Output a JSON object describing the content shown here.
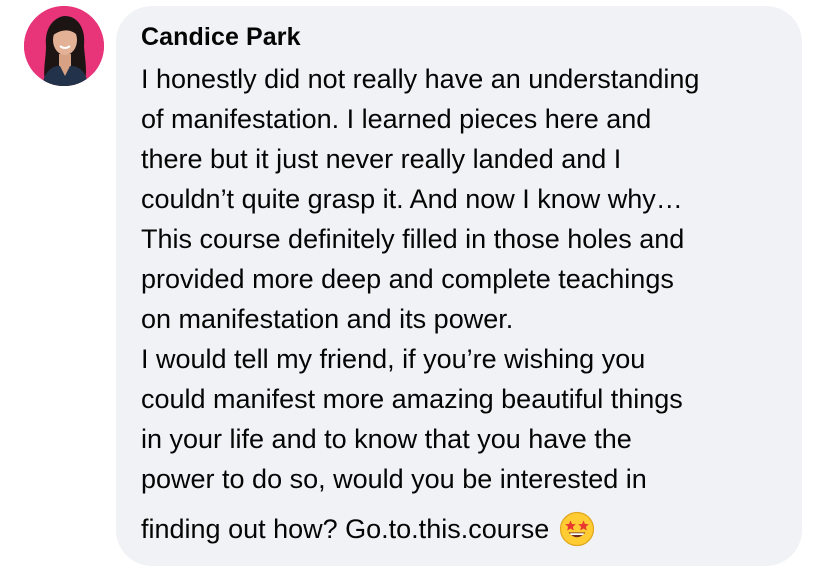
{
  "comment": {
    "author": "Candice Park",
    "lines": [
      "I honestly did not really have an understanding",
      "of manifestation. I learned pieces here and",
      "there but it just never really landed and I",
      "couldn’t quite grasp it. And now I know why…",
      "This course definitely filled in those holes and",
      "provided more deep and complete teachings",
      "on manifestation and its power.",
      "I would tell my friend, if you’re wishing you",
      "could manifest more amazing beautiful things",
      "in your life and to know that you have the",
      "power to do so, would you be interested in",
      "finding out how? Go.to.this.course"
    ],
    "emoji": "star-struck-emoji"
  },
  "colors": {
    "bubble": "#f0f2f5",
    "text": "#050505",
    "avatar_bg": "#e8357a"
  }
}
